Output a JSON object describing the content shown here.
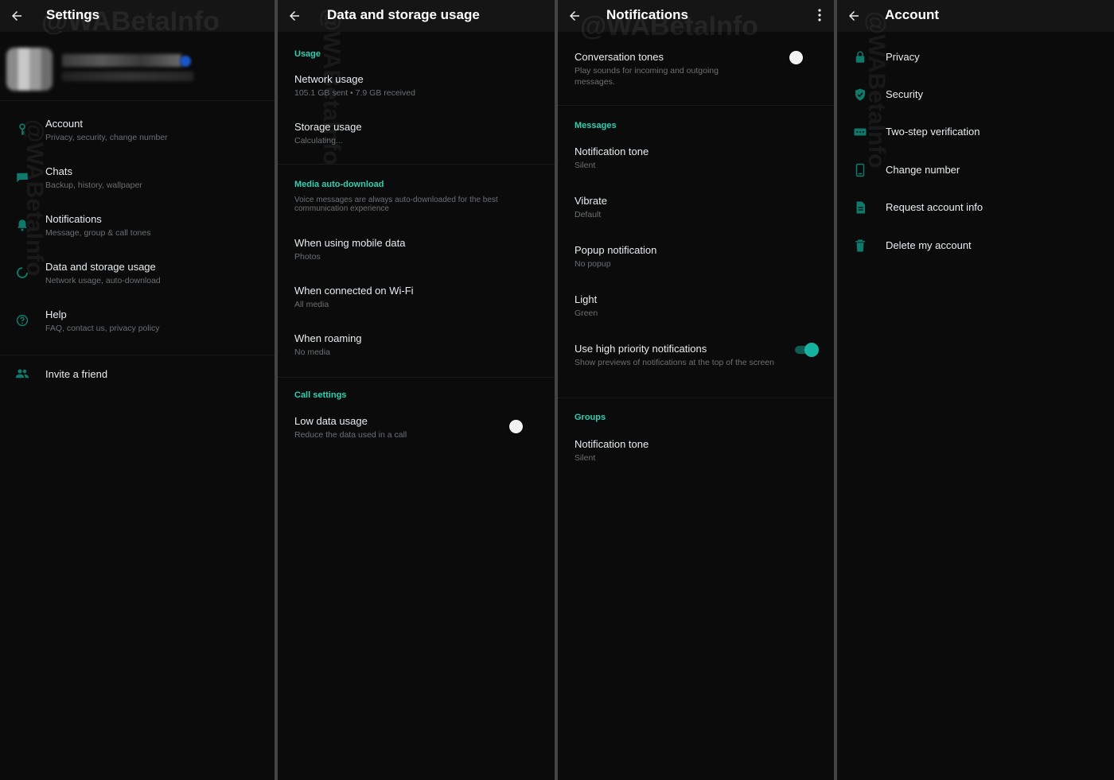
{
  "colors": {
    "background": "#0b0b0b",
    "appbar": "#151515",
    "accent": "#2fd0b3",
    "icon": "#0f7a6c",
    "primary_text": "#e9edef",
    "secondary_text": "#6b6f72"
  },
  "watermark": "@WABetaInfo",
  "settings": {
    "title": "Settings",
    "items": [
      {
        "icon": "key-icon",
        "label": "Account",
        "sub": "Privacy, security, change number"
      },
      {
        "icon": "chat-icon",
        "label": "Chats",
        "sub": "Backup, history, wallpaper"
      },
      {
        "icon": "bell-icon",
        "label": "Notifications",
        "sub": "Message, group & call tones"
      },
      {
        "icon": "data-usage-icon",
        "label": "Data and storage usage",
        "sub": "Network usage, auto-download"
      },
      {
        "icon": "help-icon",
        "label": "Help",
        "sub": "FAQ, contact us, privacy policy"
      }
    ],
    "invite": {
      "icon": "people-icon",
      "label": "Invite a friend"
    }
  },
  "data_storage": {
    "title": "Data and storage usage",
    "usage_header": "Usage",
    "network_usage": {
      "label": "Network usage",
      "sub": "105.1 GB sent • 7.9 GB received"
    },
    "storage_usage": {
      "label": "Storage usage",
      "sub": "Calculating..."
    },
    "media_header": "Media auto-download",
    "media_note": "Voice messages are always auto-downloaded for the best communication experience",
    "mobile_data": {
      "label": "When using mobile data",
      "sub": "Photos"
    },
    "wifi": {
      "label": "When connected on Wi-Fi",
      "sub": "All media"
    },
    "roaming": {
      "label": "When roaming",
      "sub": "No media"
    },
    "call_header": "Call settings",
    "low_data": {
      "label": "Low data usage",
      "sub": "Reduce the data used in a call",
      "enabled": false
    }
  },
  "notifications": {
    "title": "Notifications",
    "conversation_tones": {
      "label": "Conversation tones",
      "sub": "Play sounds for incoming and outgoing messages.",
      "enabled": false
    },
    "messages_header": "Messages",
    "msg_tone": {
      "label": "Notification tone",
      "sub": "Silent"
    },
    "vibrate": {
      "label": "Vibrate",
      "sub": "Default"
    },
    "popup": {
      "label": "Popup notification",
      "sub": "No popup"
    },
    "light": {
      "label": "Light",
      "sub": "Green"
    },
    "high_priority": {
      "label": "Use high priority notifications",
      "sub": "Show previews of notifications at the top of the screen",
      "enabled": true
    },
    "groups_header": "Groups",
    "group_tone": {
      "label": "Notification tone",
      "sub": "Silent"
    }
  },
  "account": {
    "title": "Account",
    "items": [
      {
        "icon": "lock-icon",
        "label": "Privacy"
      },
      {
        "icon": "shield-icon",
        "label": "Security"
      },
      {
        "icon": "dialpad-icon",
        "label": "Two-step verification"
      },
      {
        "icon": "phone-swap-icon",
        "label": "Change number"
      },
      {
        "icon": "document-icon",
        "label": "Request account info"
      },
      {
        "icon": "trash-icon",
        "label": "Delete my account"
      }
    ]
  }
}
